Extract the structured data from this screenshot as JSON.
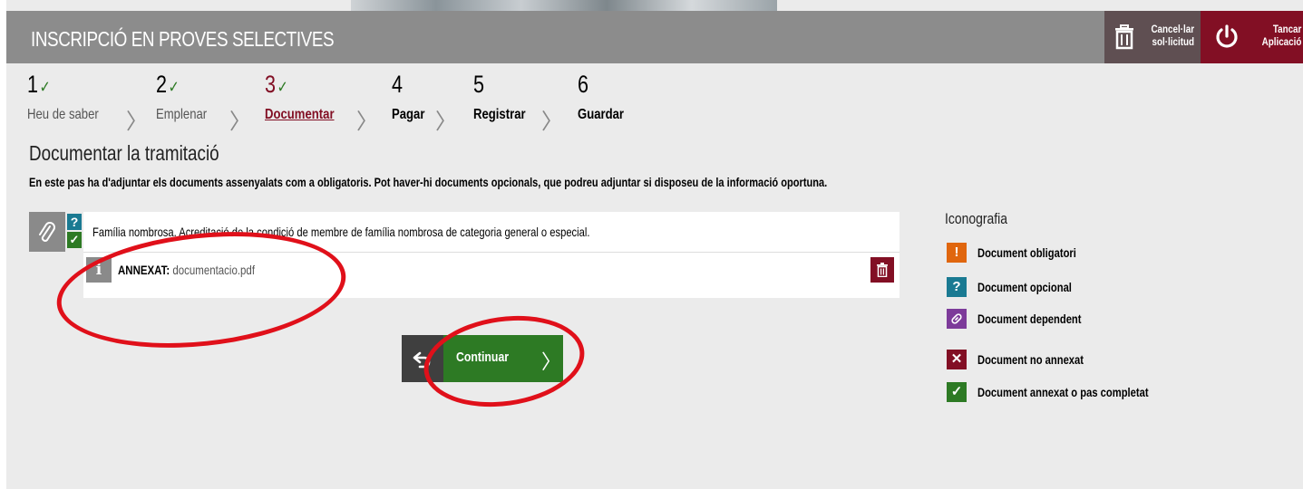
{
  "header": {
    "title": "INSCRIPCIÓ EN PROVES SELECTIVES",
    "cancel_line1": "Cancel·lar",
    "cancel_line2": "sol·licitud",
    "close_line1": "Tancar",
    "close_line2": "Aplicació"
  },
  "steps": [
    {
      "num": "1",
      "label": "Heu de saber",
      "state": "done"
    },
    {
      "num": "2",
      "label": "Emplenar",
      "state": "done"
    },
    {
      "num": "3",
      "label": "Documentar",
      "state": "active"
    },
    {
      "num": "4",
      "label": "Pagar",
      "state": "future"
    },
    {
      "num": "5",
      "label": "Registrar",
      "state": "future"
    },
    {
      "num": "6",
      "label": "Guardar",
      "state": "future"
    }
  ],
  "check_mark": "✓",
  "main": {
    "title": "Documentar la tramitació",
    "intro": "En este pas ha d'adjuntar els documents assenyalats com a obligatoris. Pot haver-hi documents opcionals, que podreu adjuntar si disposeu de la informació oportuna."
  },
  "document": {
    "description": "Família nombrosa. Acreditació de la condició de membre de família nombrosa de categoria general o especial.",
    "annex_label": "ANNEXAT:",
    "annex_file": "documentacio.pdf",
    "badge_optional": "?",
    "info_glyph": "i"
  },
  "buttons": {
    "continue_label": "Continuar"
  },
  "legend": {
    "title": "Iconografia",
    "items": [
      {
        "label": "Document obligatori",
        "color": "#e0660e",
        "glyph": "!",
        "icon": "exclamation-icon"
      },
      {
        "label": "Document opcional",
        "color": "#1a7a92",
        "glyph": "?",
        "icon": "question-icon"
      },
      {
        "label": "Document dependent",
        "color": "#7d3b9a",
        "glyph": "🔗",
        "icon": "link-icon"
      },
      {
        "label": "Document no annexat",
        "color": "#820f24",
        "glyph": "✕",
        "icon": "cross-icon"
      },
      {
        "label": "Document annexat o pas completat",
        "color": "#2d7a24",
        "glyph": "✓",
        "icon": "check-icon"
      }
    ]
  },
  "colors": {
    "header_bg": "#8c8c8c",
    "brand_red": "#820f24",
    "success_green": "#2d7a24",
    "annotation_red": "#e0101a"
  }
}
